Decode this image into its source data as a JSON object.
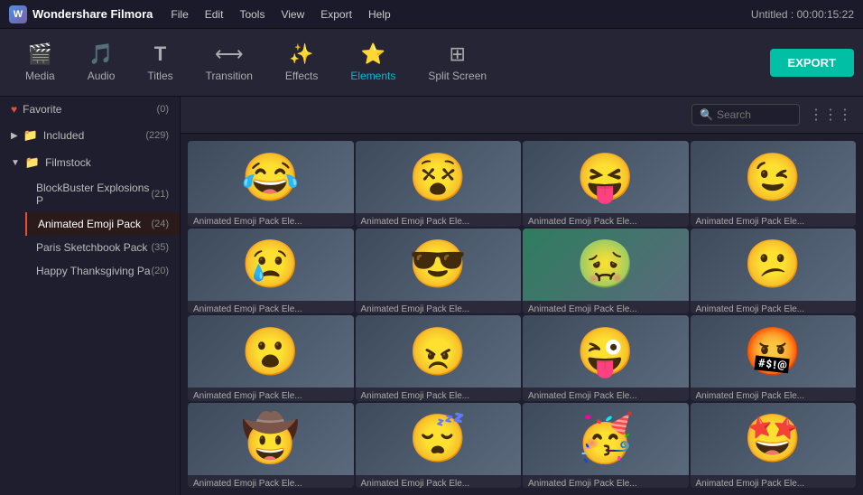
{
  "app": {
    "name": "Wondershare Filmora",
    "title": "Untitled : 00:00:15:22"
  },
  "menu": {
    "items": [
      "File",
      "Edit",
      "Tools",
      "View",
      "Export",
      "Help"
    ]
  },
  "toolbar": {
    "items": [
      {
        "id": "media",
        "label": "Media",
        "icon": "🎬"
      },
      {
        "id": "audio",
        "label": "Audio",
        "icon": "🎵"
      },
      {
        "id": "titles",
        "label": "Titles",
        "icon": "T"
      },
      {
        "id": "transition",
        "label": "Transition",
        "icon": "⟷"
      },
      {
        "id": "effects",
        "label": "Effects",
        "icon": "✨"
      },
      {
        "id": "elements",
        "label": "Elements",
        "icon": "⭐"
      },
      {
        "id": "split-screen",
        "label": "Split Screen",
        "icon": "⊞"
      }
    ],
    "active": "elements",
    "export_label": "EXPORT"
  },
  "sidebar": {
    "favorite": {
      "label": "Favorite",
      "count": "(0)"
    },
    "included": {
      "label": "Included",
      "count": "(229)",
      "expanded": false
    },
    "filmstock": {
      "label": "Filmstock",
      "expanded": true,
      "children": [
        {
          "id": "blockbuster",
          "label": "BlockBuster Explosions P",
          "count": "(21)"
        },
        {
          "id": "animated-emoji",
          "label": "Animated Emoji Pack",
          "count": "(24)",
          "active": true
        },
        {
          "id": "paris",
          "label": "Paris Sketchbook Pack",
          "count": "(35)"
        },
        {
          "id": "thanksgiving",
          "label": "Happy Thanksgiving Pa",
          "count": "(20)"
        }
      ]
    }
  },
  "search": {
    "placeholder": "Search",
    "value": ""
  },
  "grid_items": [
    {
      "id": 1,
      "label": "Animated Emoji Pack Ele...",
      "emoji": "😂",
      "bg": "#3d4a5c"
    },
    {
      "id": 2,
      "label": "Animated Emoji Pack Ele...",
      "emoji": "😵",
      "bg": "#3d4a5c"
    },
    {
      "id": 3,
      "label": "Animated Emoji Pack Ele...",
      "emoji": "😝",
      "bg": "#3d4a5c"
    },
    {
      "id": 4,
      "label": "Animated Emoji Pack Ele...",
      "emoji": "😉",
      "bg": "#3d4a5c"
    },
    {
      "id": 5,
      "label": "Animated Emoji Pack Ele...",
      "emoji": "😢",
      "bg": "#3d4a5c"
    },
    {
      "id": 6,
      "label": "Animated Emoji Pack Ele...",
      "emoji": "😎",
      "bg": "#3d4a5c"
    },
    {
      "id": 7,
      "label": "Animated Emoji Pack Ele...",
      "emoji": "🤢",
      "bg": "#2e7d5e"
    },
    {
      "id": 8,
      "label": "Animated Emoji Pack Ele...",
      "emoji": "😕",
      "bg": "#3d4a5c"
    },
    {
      "id": 9,
      "label": "Animated Emoji Pack Ele...",
      "emoji": "😮",
      "bg": "#3d4a5c"
    },
    {
      "id": 10,
      "label": "Animated Emoji Pack Ele...",
      "emoji": "😠",
      "bg": "#3d4a5c"
    },
    {
      "id": 11,
      "label": "Animated Emoji Pack Ele...",
      "emoji": "😜",
      "bg": "#3d4a5c"
    },
    {
      "id": 12,
      "label": "Animated Emoji Pack Ele...",
      "emoji": "🤬",
      "bg": "#3d4a5c"
    },
    {
      "id": 13,
      "label": "Animated Emoji Pack Ele...",
      "emoji": "🤠",
      "bg": "#3d4a5c"
    },
    {
      "id": 14,
      "label": "Animated Emoji Pack Ele...",
      "emoji": "😴",
      "bg": "#3d4a5c"
    },
    {
      "id": 15,
      "label": "Animated Emoji Pack Ele...",
      "emoji": "🥳",
      "bg": "#3d4a5c"
    },
    {
      "id": 16,
      "label": "Animated Emoji Pack Ele...",
      "emoji": "🤩",
      "bg": "#3d4a5c"
    }
  ]
}
